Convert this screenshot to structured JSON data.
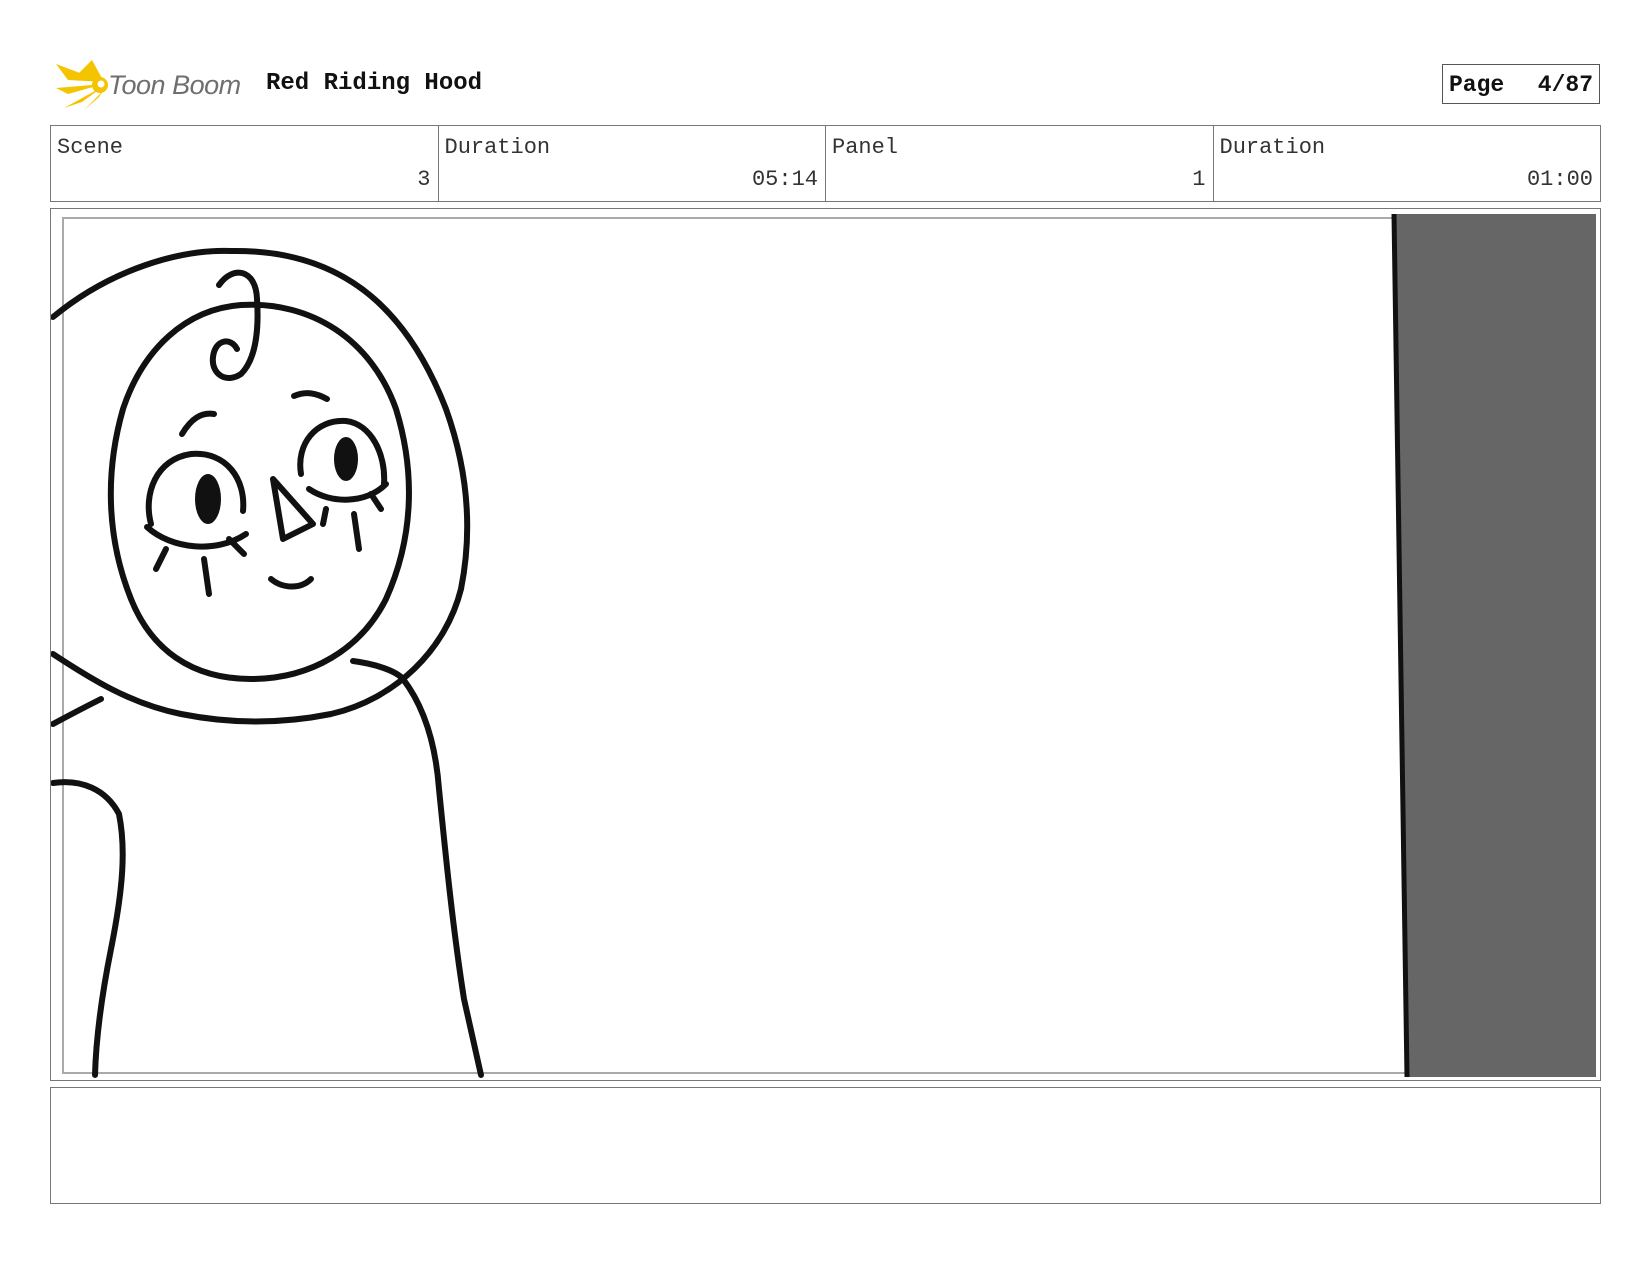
{
  "header": {
    "logo_text": "Toon Boom",
    "project_title": "Red Riding Hood",
    "page_label": "Page",
    "page_value": "4/87"
  },
  "info": {
    "scene_label": "Scene",
    "scene_value": "3",
    "scene_duration_label": "Duration",
    "scene_duration_value": "05:14",
    "panel_label": "Panel",
    "panel_value": "1",
    "panel_duration_label": "Duration",
    "panel_duration_value": "01:00"
  },
  "notes": {
    "text": ""
  },
  "colors": {
    "logo_star": "#f5c400",
    "shadow_area": "#666666"
  }
}
